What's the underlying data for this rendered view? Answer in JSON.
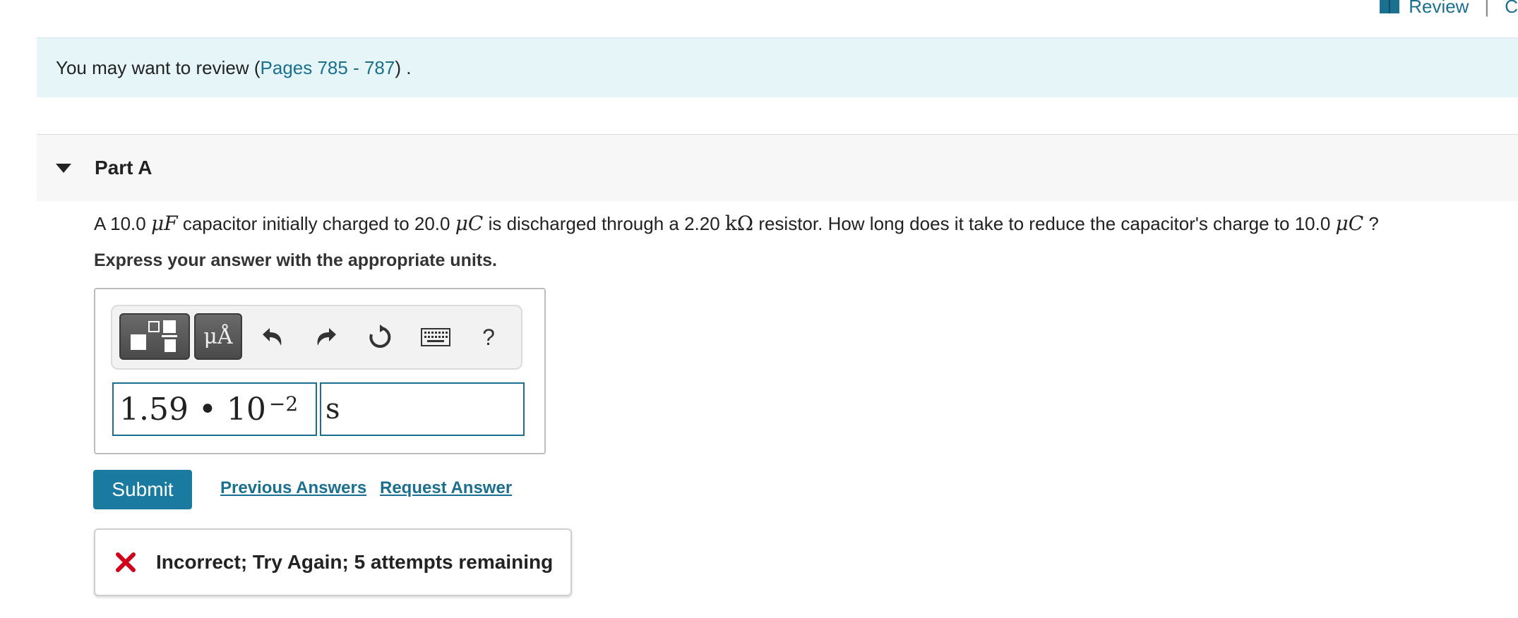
{
  "top_links": {
    "review_label": "Review",
    "separator": "|",
    "next_label": "C"
  },
  "review_banner": {
    "prefix": "You may want to review (",
    "link_text": "Pages 785 - 787",
    "suffix": ") ."
  },
  "part": {
    "title": "Part A"
  },
  "question": {
    "t1": "A 10.0 ",
    "u1": "μF",
    "t2": " capacitor initially charged to 20.0 ",
    "u2": "μC",
    "t3": " is discharged through a 2.20 ",
    "u3": "kΩ",
    "t4": " resistor. How long does it take to reduce the capacitor's charge to 10.0 ",
    "u4": "μC",
    "t5": " ?"
  },
  "instruction": "Express your answer with the appropriate units.",
  "toolbar": {
    "units_label": "μÅ",
    "help_label": "?",
    "icons": [
      "templates-icon",
      "units-icon",
      "undo-icon",
      "redo-icon",
      "reset-icon",
      "keyboard-icon",
      "help-icon"
    ]
  },
  "answer": {
    "value_mantissa": "1.59 • 10",
    "value_exponent": "−2",
    "unit": "s"
  },
  "actions": {
    "submit_label": "Submit",
    "previous_answers_label": "Previous Answers",
    "request_answer_label": "Request Answer"
  },
  "feedback": {
    "message": "Incorrect; Try Again; 5 attempts remaining"
  },
  "colors": {
    "link": "#1b6f8f",
    "submit_bg": "#1a7aa0",
    "banner_bg": "#e6f6f8",
    "error_icon": "#d0021b"
  }
}
